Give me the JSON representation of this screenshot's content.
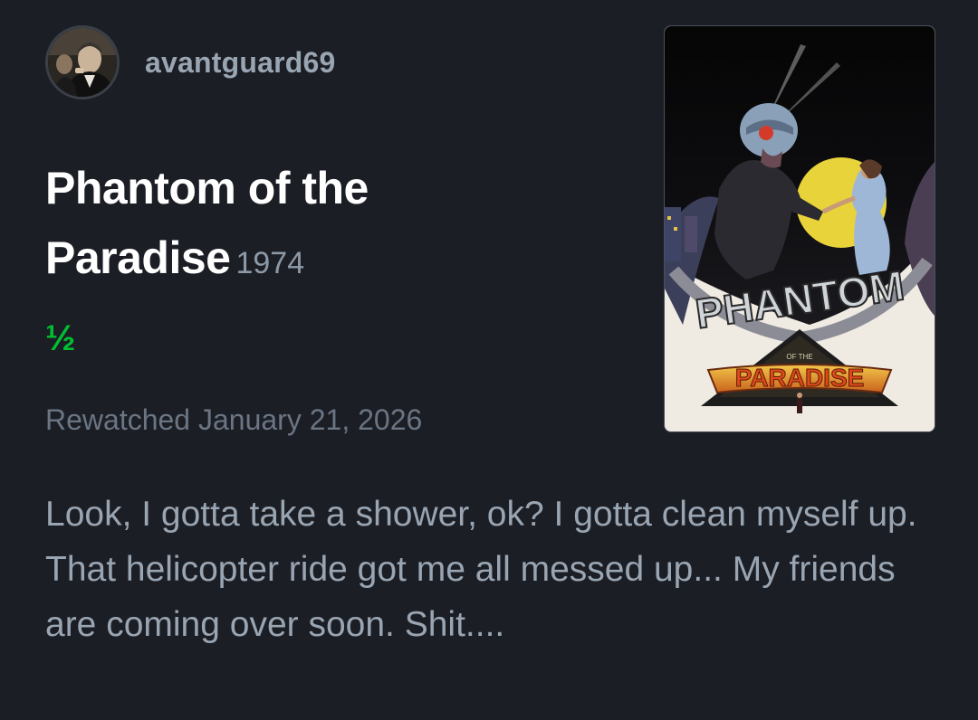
{
  "user": {
    "username": "avantguard69"
  },
  "film": {
    "title": "Phantom of the Paradise",
    "year": "1974"
  },
  "rating": {
    "display": "½",
    "stars": 0.5,
    "color": "#00c030"
  },
  "watched": {
    "label": "Rewatched January 21, 2026"
  },
  "review": {
    "text": "Look, I gotta take a shower, ok? I gotta clean myself up. That helicopter ride got me all messed up... My friends are coming over soon. Shit...."
  },
  "poster": {
    "title_line1": "PHANTOM",
    "title_small": "OF THE",
    "title_line2": "PARADISE"
  },
  "colors": {
    "background": "#1b1e24",
    "username": "#9aa5b3",
    "title": "#ffffff",
    "muted": "#6b7583",
    "body": "#9aa5b3"
  }
}
